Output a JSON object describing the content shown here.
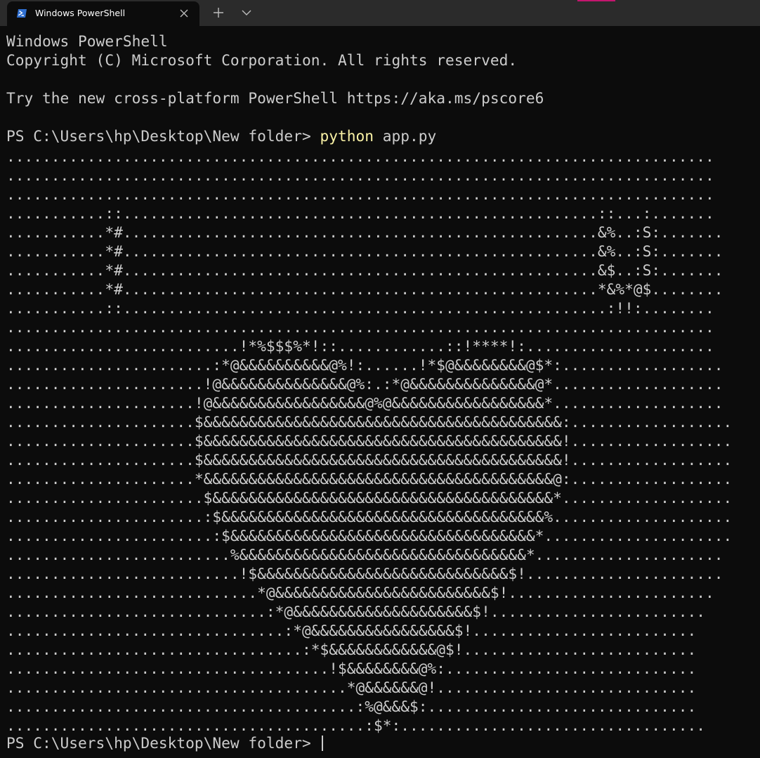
{
  "window": {
    "tab_title": "Windows PowerShell",
    "tab_icon": "powershell-icon",
    "close_icon": "close-icon",
    "new_tab_icon": "plus-icon",
    "dropdown_icon": "chevron-down-icon",
    "colors": {
      "titlebar": "#2b2b2b",
      "tab_active": "#0c0c0c",
      "background": "#0c0c0c",
      "foreground": "#cccccc",
      "command": "#f9f1a5",
      "powershell_icon": "#2f6fd0",
      "accent_strip": "#c3166e"
    }
  },
  "terminal": {
    "banner": [
      "Windows PowerShell",
      "Copyright (C) Microsoft Corporation. All rights reserved.",
      "",
      "Try the new cross-platform PowerShell https://aka.ms/pscore6",
      ""
    ],
    "prompt": "PS C:\\Users\\hp\\Desktop\\New folder> ",
    "command": "python",
    "command_args": " app.py",
    "output_lines": [
      "...............................................................................",
      "...............................................................................",
      "...............................................................................",
      "...........::.....................................................::...:.......",
      "...........*#.....................................................&%..:S:.......",
      "...........*#.....................................................&%..:S:.......",
      "...........*#.....................................................&$..:S:.......",
      "...........*#.....................................................*&%*@$........",
      "...........::......................................................:!!:........",
      "...............................................................................",
      "..........................!*%$$$%*!::............::!****!:.....................",
      ".......................:*@&&&&&&&&&&@%!:......!*$@&&&&&&&&@$*:..................",
      "......................!@&&&&&&&&&&&&&&@%:.:*@&&&&&&&&&&&&&&@*...................",
      ".....................!@&&&&&&&&&&&&&&&&&@%@&&&&&&&&&&&&&&&&&*...................",
      ".....................$&&&&&&&&&&&&&&&&&&&&&&&&&&&&&&&&&&&&&&&&:..................",
      ".....................$&&&&&&&&&&&&&&&&&&&&&&&&&&&&&&&&&&&&&&&&!..................",
      ".....................$&&&&&&&&&&&&&&&&&&&&&&&&&&&&&&&&&&&&&&&&!..................",
      ".....................*&&&&&&&&&&&&&&&&&&&&&&&&&&&&&&&&&&&&&&&@:..................",
      "......................$&&&&&&&&&&&&&&&&&&&&&&&&&&&&&&&&&&&&&&*...................",
      "......................:$&&&&&&&&&&&&&&&&&&&&&&&&&&&&&&&&&&&&%....................",
      ".......................:$&&&&&&&&&&&&&&&&&&&&&&&&&&&&&&&&&&*.....................",
      ".........................%&&&&&&&&&&&&&&&&&&&&&&&&&&&&&&&&*.....................",
      "..........................!$&&&&&&&&&&&&&&&&&&&&&&&&&&&&$!......................",
      "............................*@&&&&&&&&&&&&&&&&&&&&&&&&$!.......................",
      ".............................:*@&&&&&&&&&&&&&&&&&&&&$!........................",
      "...............................:*@&&&&&&&&&&&&&&&&$!.........................",
      ".................................:*$&&&&&&&&&&&&@$!..........................",
      "....................................!$&&&&&&&&@%:............................",
      "......................................*@&&&&&&@!.............................",
      ".......................................:%@&&&$:..............................",
      "........................................:$*:.................................."
    ],
    "final_prompt": "PS C:\\Users\\hp\\Desktop\\New folder> "
  }
}
